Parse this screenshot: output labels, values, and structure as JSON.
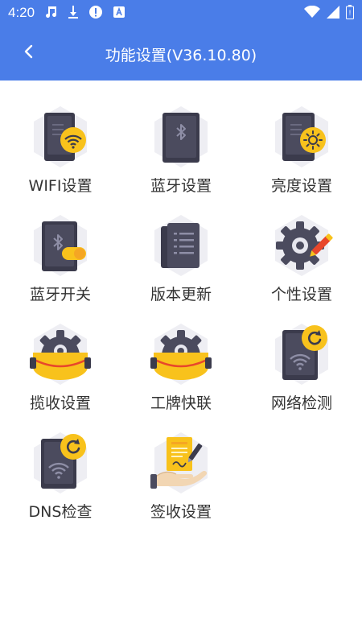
{
  "status_bar": {
    "time": "4:20",
    "icons_left": [
      "music-note-icon",
      "download-icon",
      "alert-icon",
      "text-icon"
    ],
    "icons_right": [
      "wifi-icon",
      "signal-icon",
      "battery-icon"
    ]
  },
  "header": {
    "title": "功能设置(V36.10.80)",
    "back_icon": "chevron-left-icon",
    "background": "#4a7de8"
  },
  "menu": {
    "items": [
      {
        "label": "WIFI设置",
        "icon": "wifi-settings-icon"
      },
      {
        "label": "蓝牙设置",
        "icon": "bluetooth-settings-icon"
      },
      {
        "label": "亮度设置",
        "icon": "brightness-settings-icon"
      },
      {
        "label": "蓝牙开关",
        "icon": "bluetooth-switch-icon"
      },
      {
        "label": "版本更新",
        "icon": "version-update-icon"
      },
      {
        "label": "个性设置",
        "icon": "personal-settings-icon"
      },
      {
        "label": "揽收设置",
        "icon": "pickup-settings-icon"
      },
      {
        "label": "工牌快联",
        "icon": "badge-quick-link-icon"
      },
      {
        "label": "网络检测",
        "icon": "network-check-icon"
      },
      {
        "label": "DNS检查",
        "icon": "dns-check-icon"
      },
      {
        "label": "签收设置",
        "icon": "signoff-settings-icon"
      }
    ]
  },
  "colors": {
    "device": "#4b4b5e",
    "device_dark": "#3b3b4c",
    "hex_bg": "#eeeef3",
    "accent_yellow": "#f8c21c",
    "accent_orange": "#f5a623",
    "accent_red": "#e8472b"
  }
}
